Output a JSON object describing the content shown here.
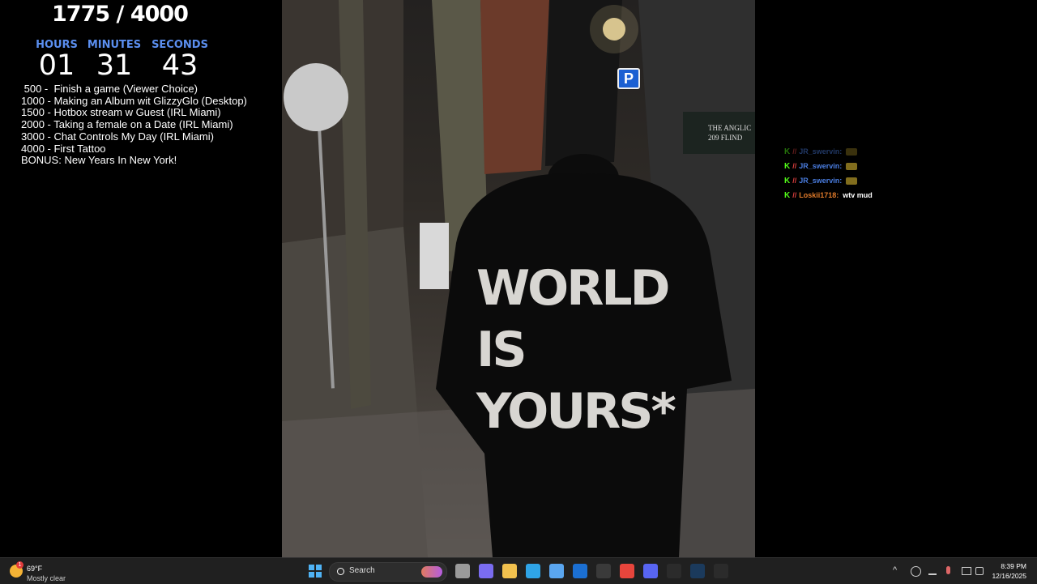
{
  "goal": {
    "text": "1775 / 4000"
  },
  "timer": {
    "hours_label": "HOURS",
    "minutes_label": "MINUTES",
    "seconds_label": "SECONDS",
    "hours": "01",
    "minutes": "31",
    "seconds": "43"
  },
  "goals": [
    " 500 -  Finish a game (Viewer Choice)",
    "1000 - Making an Album wit GlizzyGlo (Desktop)",
    "1500 - Hotbox stream w Guest (IRL Miami)",
    "2000 - Taking a female on a Date (IRL Miami)",
    "3000 - Chat Controls My Day (IRL Miami)",
    "4000 - First Tattoo",
    "BONUS: New Years In New York!"
  ],
  "photo": {
    "hoodie_lines": [
      "WORLD",
      "IS",
      "YOURS*"
    ],
    "sign_line1": "THE ANGLIC",
    "sign_line2": "209 FLIND",
    "parking": "P"
  },
  "chat": {
    "messages": [
      {
        "user": "JR_swervin:",
        "color": "#4a7de0",
        "text": "",
        "dim": true,
        "emote": true
      },
      {
        "user": "JR_swervin:",
        "color": "#4a7de0",
        "text": "",
        "dim": false,
        "emote": true
      },
      {
        "user": "JR_swervin:",
        "color": "#4a7de0",
        "text": "",
        "dim": false,
        "emote": true
      },
      {
        "user": "Loskii1718:",
        "color": "#e07a2a",
        "text": "wtv mud",
        "dim": false,
        "emote": false
      }
    ],
    "kick_glyph": "K",
    "slash_glyph": "//"
  },
  "taskbar": {
    "weather_temp": "69°F",
    "weather_desc": "Mostly clear",
    "weather_badge": "1",
    "search_label": "Search",
    "time": "8:39 PM",
    "date": "12/16/2025",
    "apps": [
      {
        "name": "task-view",
        "color": "#9a9a9a"
      },
      {
        "name": "copilot",
        "color": "#7a6cf0"
      },
      {
        "name": "file-explorer",
        "color": "#f2c14e"
      },
      {
        "name": "edge",
        "color": "#2fa4e7"
      },
      {
        "name": "microsoft-store",
        "color": "#5aa6f0"
      },
      {
        "name": "outlook",
        "color": "#1b6fd2"
      },
      {
        "name": "obs",
        "color": "#3a3a3a"
      },
      {
        "name": "chrome",
        "color": "#e8453c"
      },
      {
        "name": "discord",
        "color": "#5865f2"
      },
      {
        "name": "xbox",
        "color": "#2b2b2b"
      },
      {
        "name": "steam",
        "color": "#1b3a5c"
      },
      {
        "name": "google",
        "color": "#2b2b2b"
      }
    ]
  }
}
